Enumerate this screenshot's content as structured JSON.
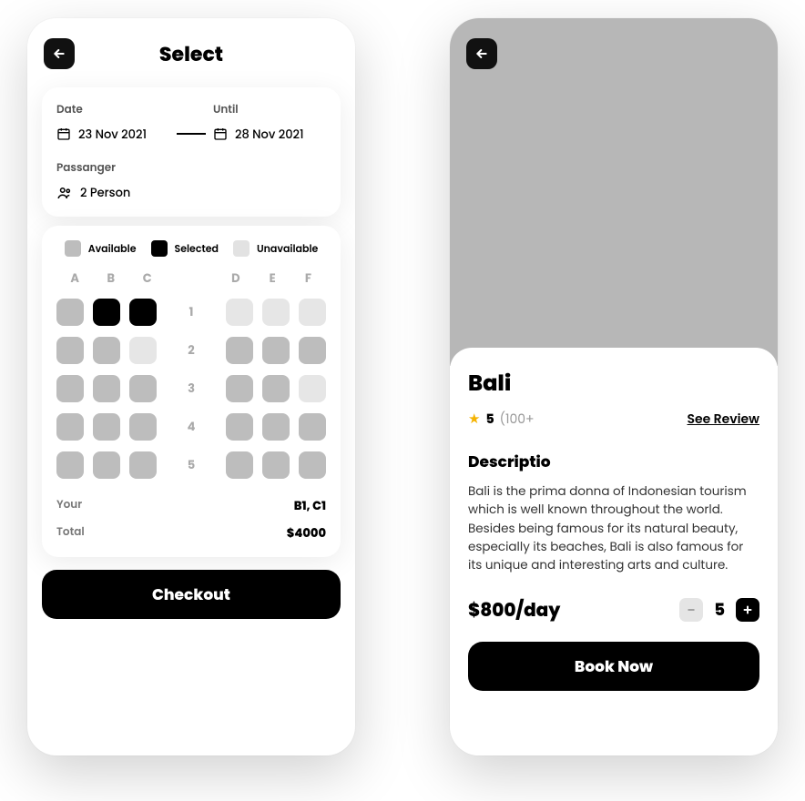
{
  "select": {
    "title": "Select",
    "date_label": "Date",
    "date_value": "23 Nov 2021",
    "until_label": "Until",
    "until_value": "28 Nov 2021",
    "passenger_label": "Passanger",
    "passenger_value": "2 Person",
    "legend": {
      "available": "Available",
      "selected": "Selected",
      "unavailable": "Unavailable"
    },
    "columns_left": [
      "A",
      "B",
      "C"
    ],
    "columns_right": [
      "D",
      "E",
      "F"
    ],
    "rows": [
      "1",
      "2",
      "3",
      "4",
      "5"
    ],
    "seat_map": [
      [
        "avail",
        "sel",
        "sel",
        "unavail",
        "unavail",
        "unavail"
      ],
      [
        "avail",
        "avail",
        "unavail",
        "avail",
        "avail",
        "avail"
      ],
      [
        "avail",
        "avail",
        "avail",
        "avail",
        "avail",
        "unavail"
      ],
      [
        "avail",
        "avail",
        "avail",
        "avail",
        "avail",
        "avail"
      ],
      [
        "avail",
        "avail",
        "avail",
        "avail",
        "avail",
        "avail"
      ]
    ],
    "your_label": "Your",
    "your_value": "B1, C1",
    "total_label": "Total",
    "total_value": "$4000",
    "checkout": "Checkout"
  },
  "detail": {
    "title": "Bali",
    "rating": "5",
    "rating_count": "(100+",
    "see_review": "See Review",
    "desc_heading": "Descriptio",
    "desc_text": "Bali is the prima donna of Indonesian tourism which is well known throughout the world. Besides being famous for its natural beauty, especially its beaches, Bali is also famous for its unique and interesting arts and culture.",
    "price": "$800/day",
    "qty": "5",
    "book_now": "Book Now"
  }
}
